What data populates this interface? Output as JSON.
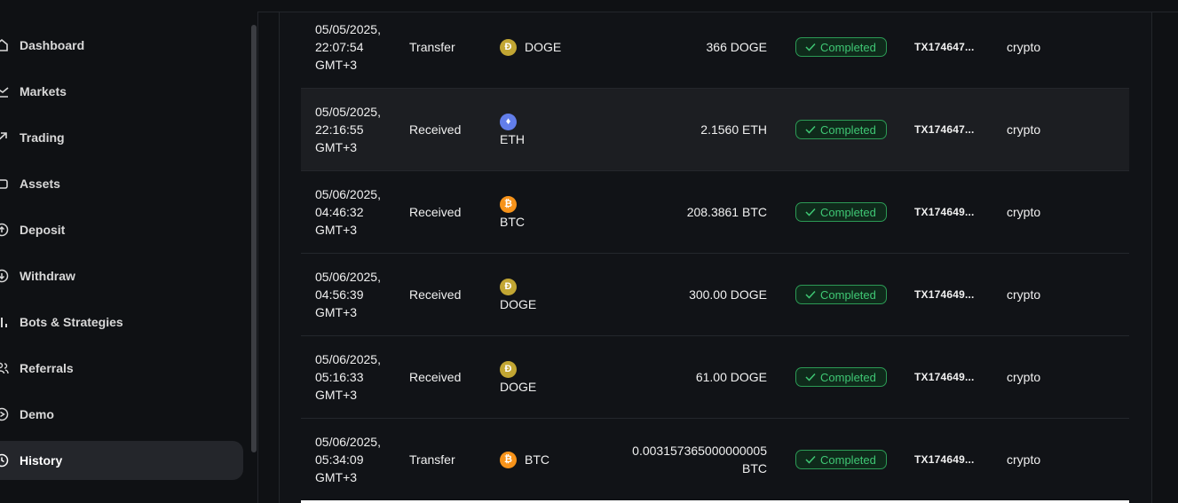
{
  "sidebar": {
    "items": [
      {
        "label": "Dashboard",
        "icon": "home-icon"
      },
      {
        "label": "Markets",
        "icon": "chart-line-icon"
      },
      {
        "label": "Trading",
        "icon": "trend-arrow-icon"
      },
      {
        "label": "Assets",
        "icon": "wallet-icon"
      },
      {
        "label": "Deposit",
        "icon": "arrow-up-circle-icon"
      },
      {
        "label": "Withdraw",
        "icon": "arrow-down-circle-icon"
      },
      {
        "label": "Bots & Strategies",
        "icon": "bar-chart-icon"
      },
      {
        "label": "Referrals",
        "icon": "users-icon"
      },
      {
        "label": "Demo",
        "icon": "play-circle-icon"
      },
      {
        "label": "History",
        "icon": "clock-icon",
        "active": true
      }
    ]
  },
  "transactions": [
    {
      "date": "05/05/2025,",
      "time": "22:07:54",
      "tz": "GMT+3",
      "type": "Transfer",
      "asset": "DOGE",
      "coin_symbol": "Ð",
      "coin_color": "#c2a633",
      "amount": "366 DOGE",
      "amount_unit": "",
      "status": "Completed",
      "tx": "TX174647...",
      "category": "crypto"
    },
    {
      "date": "05/05/2025,",
      "time": "22:16:55",
      "tz": "GMT+3",
      "type": "Received",
      "asset": "ETH",
      "coin_symbol": "♦",
      "coin_color": "#627eea",
      "amount": "2.1560 ETH",
      "amount_unit": "",
      "status": "Completed",
      "tx": "TX174647...",
      "category": "crypto"
    },
    {
      "date": "05/06/2025,",
      "time": "04:46:32",
      "tz": "GMT+3",
      "type": "Received",
      "asset": "BTC",
      "coin_symbol": "₿",
      "coin_color": "#f7931a",
      "amount": "208.3861 BTC",
      "amount_unit": "",
      "status": "Completed",
      "tx": "TX174649...",
      "category": "crypto"
    },
    {
      "date": "05/06/2025,",
      "time": "04:56:39",
      "tz": "GMT+3",
      "type": "Received",
      "asset": "DOGE",
      "coin_symbol": "Ð",
      "coin_color": "#c2a633",
      "amount": "300.00 DOGE",
      "amount_unit": "",
      "status": "Completed",
      "tx": "TX174649...",
      "category": "crypto"
    },
    {
      "date": "05/06/2025,",
      "time": "05:16:33",
      "tz": "GMT+3",
      "type": "Received",
      "asset": "DOGE",
      "coin_symbol": "Ð",
      "coin_color": "#c2a633",
      "amount": "61.00 DOGE",
      "amount_unit": "",
      "status": "Completed",
      "tx": "TX174649...",
      "category": "crypto"
    },
    {
      "date": "05/06/2025,",
      "time": "05:34:09",
      "tz": "GMT+3",
      "type": "Transfer",
      "asset": "BTC",
      "coin_symbol": "₿",
      "coin_color": "#f7931a",
      "amount": "0.003157365000000005",
      "amount_unit": "BTC",
      "status": "Completed",
      "tx": "TX174649...",
      "category": "crypto"
    }
  ],
  "colors": {
    "status_green": "#3fc774",
    "accent_bg": "#24262b"
  }
}
